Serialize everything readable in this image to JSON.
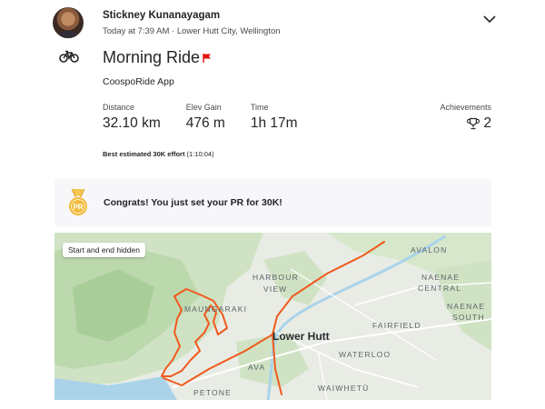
{
  "athlete": {
    "name": "Stickney Kunanayagam",
    "meta": "Today at 7:39 AM · Lower Hutt City, Wellington"
  },
  "activity": {
    "title": "Morning Ride",
    "device": "CoospoRide App",
    "sport_icon": "bike-icon",
    "flag_color": "#e3130f"
  },
  "stats": {
    "distance": {
      "label": "Distance",
      "value": "32.10 km"
    },
    "elev": {
      "label": "Elev Gain",
      "value": "476 m"
    },
    "time": {
      "label": "Time",
      "value": "1h 17m"
    },
    "achievements": {
      "label": "Achievements",
      "value": "2"
    }
  },
  "best_effort": {
    "label": "Best estimated 30K effort",
    "value": "(1:10:04)"
  },
  "congrats": {
    "text": "Congrats! You just set your PR for 30K!",
    "medal_text": "PR"
  },
  "map": {
    "chip": "Start and end hidden",
    "route_color": "#f05a1e",
    "places": {
      "avalon": "AVALON",
      "harbour_view_1": "HARBOUR",
      "harbour_view_2": "VIEW",
      "naenae_central_1": "NAENAE",
      "naenae_central_2": "CENTRAL",
      "naenae_south_1": "NAENAE",
      "naenae_south_2": "SOUTH",
      "maungaraki": "MAUNGARAKI",
      "fairfield": "FAIRFIELD",
      "lower_hutt": "Lower Hutt",
      "waterloo": "WATERLOO",
      "ava": "AVA",
      "petone": "PETONE",
      "waiwhetu": "WAIWHETŪ"
    }
  }
}
